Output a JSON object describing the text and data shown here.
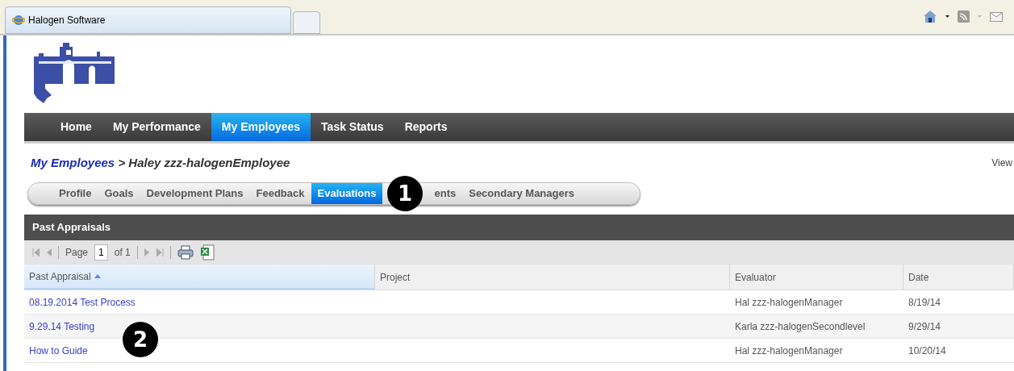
{
  "browser": {
    "tab_title": "Halogen Software"
  },
  "nav": [
    {
      "label": "Home",
      "selected": false
    },
    {
      "label": "My Performance",
      "selected": false
    },
    {
      "label": "My Employees",
      "selected": true
    },
    {
      "label": "Task Status",
      "selected": false
    },
    {
      "label": "Reports",
      "selected": false
    }
  ],
  "breadcrumb": {
    "link": "My Employees",
    "separator": ">",
    "current": "Haley zzz-halogenEmployee"
  },
  "view_link": "View",
  "subtabs": [
    {
      "label": "Profile",
      "selected": false
    },
    {
      "label": "Goals",
      "selected": false
    },
    {
      "label": "Development Plans",
      "selected": false
    },
    {
      "label": "Feedback",
      "selected": false
    },
    {
      "label": "Evaluations",
      "selected": true
    },
    {
      "label": "ents",
      "selected": false
    },
    {
      "label": "Secondary Managers",
      "selected": false
    }
  ],
  "callouts": [
    "1",
    "2"
  ],
  "panel": {
    "title": "Past Appraisals",
    "pager": {
      "page_label": "Page",
      "page": "1",
      "of_label": "of 1"
    },
    "columns": [
      {
        "label": "Past Appraisal",
        "sorted": true
      },
      {
        "label": "Project",
        "sorted": false
      },
      {
        "label": "Evaluator",
        "sorted": false
      },
      {
        "label": "Date",
        "sorted": false
      }
    ],
    "rows": [
      {
        "appraisal": "08.19.2014 Test Process",
        "evaluator": "Hal zzz-halogenManager",
        "date": "8/19/14"
      },
      {
        "appraisal": "9.29.14 Testing",
        "evaluator": "Karla zzz-halogenSecondlevel",
        "date": "9/29/14"
      },
      {
        "appraisal": "How to Guide",
        "evaluator": "Hal zzz-halogenManager",
        "date": "10/20/14"
      }
    ]
  }
}
